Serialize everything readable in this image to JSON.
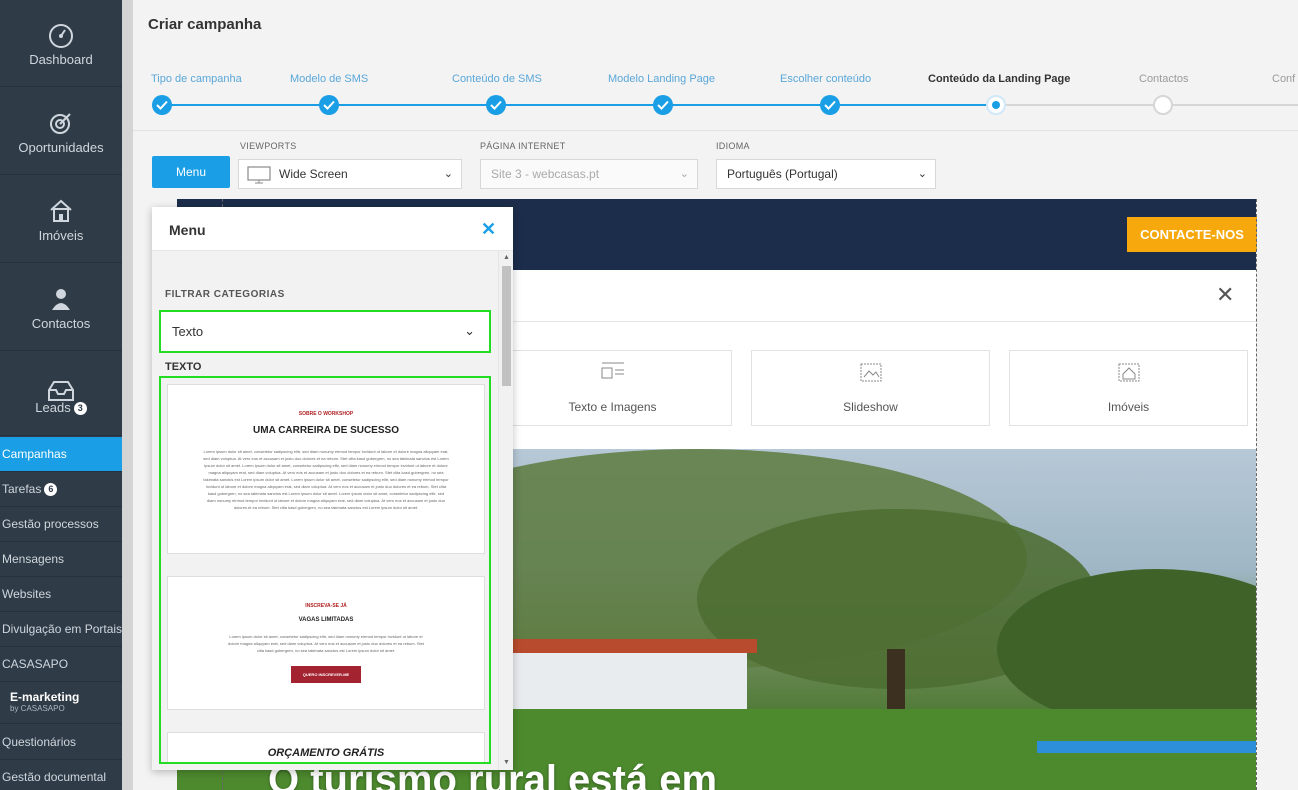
{
  "sidebar": {
    "big_items": [
      {
        "label": "Dashboard",
        "icon": "speedometer-icon"
      },
      {
        "label": "Oportunidades",
        "icon": "target-icon"
      },
      {
        "label": "Imóveis",
        "icon": "house-icon"
      },
      {
        "label": "Contactos",
        "icon": "person-icon"
      },
      {
        "label": "Leads",
        "icon": "inbox-icon",
        "badge": "3"
      }
    ],
    "items": [
      {
        "label": "Campanhas",
        "active": true
      },
      {
        "label": "Tarefas",
        "badge": "6"
      },
      {
        "label": "Gestão processos"
      },
      {
        "label": "Mensagens"
      },
      {
        "label": "Websites"
      },
      {
        "label": "Divulgação em Portais"
      },
      {
        "label": "CASASAPO"
      }
    ],
    "emarketing": {
      "title": "E-marketing",
      "subtitle": "by CASASAPO"
    },
    "items_bottom": [
      {
        "label": "Questionários"
      },
      {
        "label": "Gestão documental"
      }
    ]
  },
  "header": {
    "title": "Criar campanha"
  },
  "steps": [
    {
      "label": "Tipo de campanha",
      "state": "done"
    },
    {
      "label": "Modelo de SMS",
      "state": "done"
    },
    {
      "label": "Conteúdo de SMS",
      "state": "done"
    },
    {
      "label": "Modelo Landing Page",
      "state": "done"
    },
    {
      "label": "Escolher conteúdo",
      "state": "done"
    },
    {
      "label": "Conteúdo da Landing Page",
      "state": "current"
    },
    {
      "label": "Contactos",
      "state": "future"
    },
    {
      "label": "Conf",
      "state": "future"
    }
  ],
  "toolbar": {
    "menu_label": "Menu",
    "viewports_label": "VIEWPORTS",
    "viewport_value": "Wide Screen",
    "pagina_label": "PÁGINA INTERNET",
    "pagina_value": "Site 3 - webcasas.pt",
    "idioma_label": "IDIOMA",
    "idioma_value": "Português (Portugal)"
  },
  "preview": {
    "contact_button": "CONTACTE-NOS",
    "blocks": [
      {
        "label": "Texto e Imagens",
        "icon": "text-image-icon"
      },
      {
        "label": "Slideshow",
        "icon": "slideshow-icon"
      },
      {
        "label": "Imóveis",
        "icon": "property-icon"
      }
    ],
    "hero_text": "O turismo rural está em"
  },
  "panel": {
    "title": "Menu",
    "filter_label": "FILTRAR CATEGORIAS",
    "filter_value": "Texto",
    "section_label": "TEXTO",
    "templates": [
      {
        "kicker": "SOBRE O WORKSHOP",
        "heading": "UMA CARREIRA DE SUCESSO",
        "body": "Lorem ipsum dolor sit amet, consetetur sadipscing elitr, sed diam nonumy eirmod tempor invidunt ut labore et dolore magna aliquyam erat, sed diam voluptua. At vero eos et accusam et justo duo dolores et ea rebum. Stet clita kasd gubergren, no sea takimata sanctus est Lorem ipsum dolor sit amet. Lorem ipsum dolor sit amet, consetetur sadipscing elitr, sed diam nonumy eirmod tempor invidunt ut labore et dolore magna aliquyam erat, sed diam voluptua. At vero eos et accusam et justo duo dolores et ea rebum. Stet clita kasd gubergren, no sea takimata sanctus est Lorem ipsum dolor sit amet. Lorem ipsum dolor sit amet, consetetur sadipscing elitr, sed diam nonumy eirmod tempor invidunt ut labore et dolore magna aliquyam erat, sed diam voluptua. At vero eos et accusam et justo duo dolores et ea rebum. Stet clita kasd gubergren, no sea takimata sanctus est Lorem ipsum dolor sit amet. Lorem ipsum dolor sit amet, consetetur sadipscing elitr, sed diam nonumy eirmod tempor invidunt ut labore et dolore magna aliquyam erat, sed diam voluptua. At vero eos et accusam et justo duo dolores et ea rebum. Stet clita kasd gubergren, no sea takimata sanctus est Lorem ipsum dolor sit amet."
      },
      {
        "kicker": "INSCREVA-SE JÁ",
        "heading": "VAGAS LIMITADAS",
        "body": "Lorem ipsum dolor sit amet, consetetur sadipscing elitr, sed diam nonumy eirmod tempor invidunt ut labore et dolore magna aliquyam erat, sed diam voluptua. At vero eos et accusam et justo duo dolores et ea rebum. Stet clita kasd gubergren, no sea takimata sanctus est Lorem ipsum dolor sit amet.",
        "button": "QUERO INSCREVER-ME"
      },
      {
        "heading": "ORÇAMENTO GRÁTIS"
      }
    ]
  }
}
